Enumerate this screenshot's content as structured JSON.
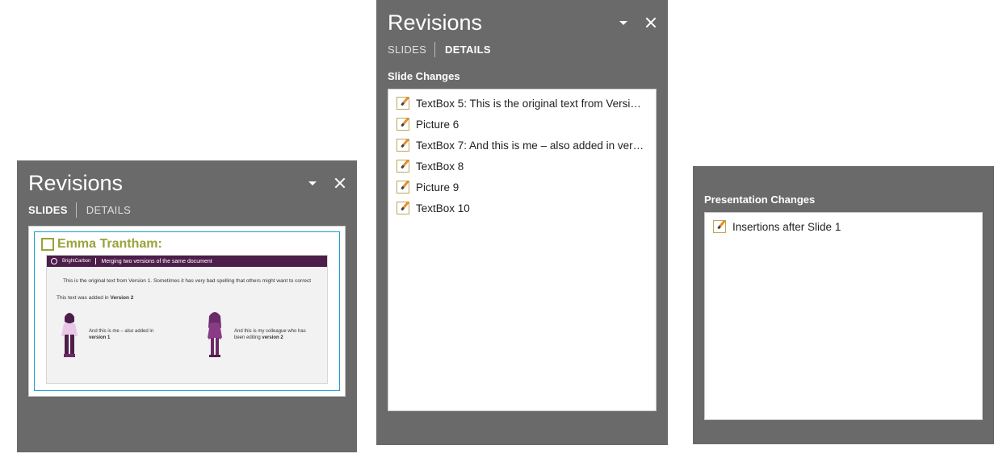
{
  "pane_title": "Revisions",
  "tabs": {
    "slides": "SLIDES",
    "details": "DETAILS"
  },
  "sections": {
    "slide_changes": "Slide Changes",
    "presentation_changes": "Presentation Changes"
  },
  "slide_thumb": {
    "author": "Emma Trantham:",
    "title_bar_brand": "BrightCarbon",
    "title_bar_text": "Merging two versions of the same document",
    "line1": "This is the original text from Version 1. Sometimes it has very bad spelling that others might want to correct",
    "line2_prefix": "This text was added in ",
    "line2_bold": "Version 2",
    "fig1_prefix": "And this is me – also added in ",
    "fig1_bold": "version 1",
    "fig2_prefix": "And this is my colleague who has been editing ",
    "fig2_bold": "version 2"
  },
  "slide_changes": [
    "TextBox 5: This is the original text from Versi…",
    "Picture 6",
    "TextBox 7: And this is me – also added in ver…",
    "TextBox 8",
    "Picture 9",
    "TextBox 10"
  ],
  "presentation_changes": [
    "Insertions after Slide 1"
  ]
}
